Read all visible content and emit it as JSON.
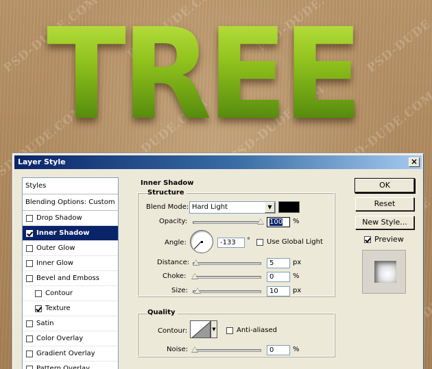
{
  "artwork": {
    "title_text": "TREE",
    "watermark_text": "PSD-DUDE.COM",
    "fill_color": "#7fb318"
  },
  "dialog": {
    "title": "Layer Style",
    "close_glyph": "×",
    "styles_list": {
      "header": "Styles",
      "blending_options": "Blending Options: Custom",
      "items": [
        {
          "label": "Drop Shadow",
          "checked": false,
          "selected": false,
          "indent": false
        },
        {
          "label": "Inner Shadow",
          "checked": true,
          "selected": true,
          "indent": false
        },
        {
          "label": "Outer Glow",
          "checked": false,
          "selected": false,
          "indent": false
        },
        {
          "label": "Inner Glow",
          "checked": false,
          "selected": false,
          "indent": false
        },
        {
          "label": "Bevel and Emboss",
          "checked": false,
          "selected": false,
          "indent": false
        },
        {
          "label": "Contour",
          "checked": false,
          "selected": false,
          "indent": true
        },
        {
          "label": "Texture",
          "checked": true,
          "selected": false,
          "indent": true
        },
        {
          "label": "Satin",
          "checked": false,
          "selected": false,
          "indent": false
        },
        {
          "label": "Color Overlay",
          "checked": false,
          "selected": false,
          "indent": false
        },
        {
          "label": "Gradient Overlay",
          "checked": false,
          "selected": false,
          "indent": false
        },
        {
          "label": "Pattern Overlay",
          "checked": false,
          "selected": false,
          "indent": false
        }
      ]
    },
    "panel": {
      "section_title": "Inner Shadow",
      "structure": {
        "title": "Structure",
        "blend_mode_label": "Blend Mode:",
        "blend_mode_value": "Hard Light",
        "shadow_color": "#000000",
        "opacity_label": "Opacity:",
        "opacity_value": "100",
        "opacity_unit": "%",
        "opacity_level": 1.0,
        "angle_label": "Angle:",
        "angle_value": "-133",
        "angle_unit": "°",
        "use_global_light_label": "Use Global Light",
        "use_global_light_checked": false,
        "distance_label": "Distance:",
        "distance_value": "5",
        "distance_unit": "px",
        "distance_level": 0.02,
        "choke_label": "Choke:",
        "choke_value": "0",
        "choke_unit": "%",
        "choke_level": 0.0,
        "size_label": "Size:",
        "size_value": "10",
        "size_unit": "px",
        "size_level": 0.04
      },
      "quality": {
        "title": "Quality",
        "contour_label": "Contour:",
        "anti_aliased_label": "Anti-aliased",
        "anti_aliased_checked": false,
        "noise_label": "Noise:",
        "noise_value": "0",
        "noise_unit": "%",
        "noise_level": 0.0
      }
    },
    "buttons": {
      "ok": "OK",
      "reset": "Reset",
      "new_style": "New Style...",
      "preview_label": "Preview",
      "preview_checked": true
    }
  }
}
